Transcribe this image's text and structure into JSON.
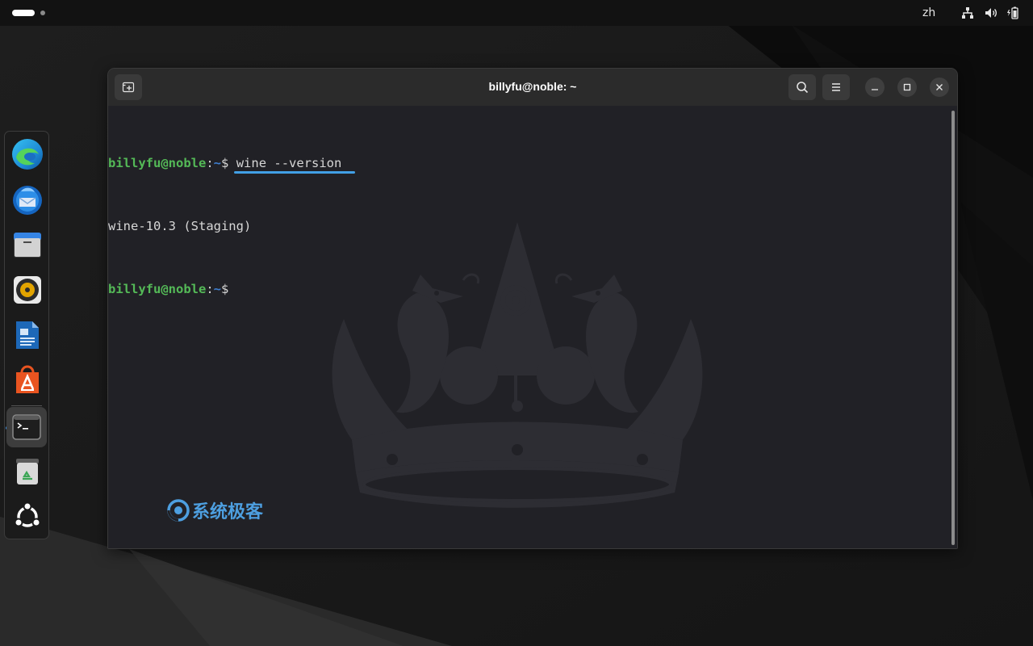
{
  "top_bar": {
    "language": "zh",
    "icons": [
      "activities-indicator",
      "network-icon",
      "volume-icon",
      "battery-icon"
    ]
  },
  "dock": {
    "apps": [
      {
        "name": "Microsoft Edge",
        "icon": "edge-icon"
      },
      {
        "name": "Thunderbird",
        "icon": "thunderbird-icon"
      },
      {
        "name": "Files",
        "icon": "files-icon"
      },
      {
        "name": "Rhythmbox",
        "icon": "rhythmbox-icon"
      },
      {
        "name": "LibreOffice Writer",
        "icon": "writer-icon"
      },
      {
        "name": "App Center",
        "icon": "app-center-icon"
      },
      {
        "name": "Terminal",
        "icon": "terminal-icon",
        "running": true
      },
      {
        "name": "Trash",
        "icon": "trash-icon"
      },
      {
        "name": "Show Apps",
        "icon": "ubuntu-apps-icon"
      }
    ]
  },
  "terminal": {
    "title": "billyfu@noble: ~",
    "lines": [
      {
        "user": "billyfu@noble",
        "colon": ":",
        "path": "~",
        "dollar": "$",
        "command": "wine --version"
      },
      {
        "output": "wine-10.3 (Staging)"
      },
      {
        "user": "billyfu@noble",
        "colon": ":",
        "path": "~",
        "dollar": "$",
        "command": ""
      }
    ],
    "watermark": "系统极客"
  },
  "colors": {
    "prompt_user": "#54b957",
    "prompt_path": "#3f7fd0",
    "highlight": "#42a0e6"
  }
}
